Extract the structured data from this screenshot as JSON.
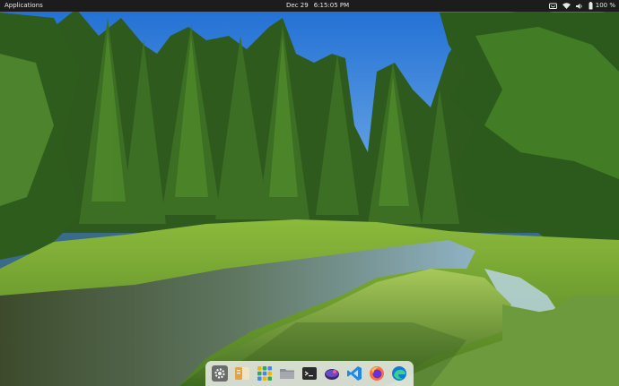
{
  "top_panel": {
    "applications_label": "Applications",
    "date": "Dec 29",
    "time": "6:15:05 PM",
    "battery_percent": "100 %",
    "tray_icons": [
      "notifications-icon",
      "network-icon",
      "volume-icon",
      "battery-icon"
    ]
  },
  "dock": {
    "items": [
      {
        "name": "settings-icon"
      },
      {
        "name": "files-icon"
      },
      {
        "name": "app-center-icon"
      },
      {
        "name": "folder-icon"
      },
      {
        "name": "terminal-icon"
      },
      {
        "name": "slack-icon"
      },
      {
        "name": "vscode-icon"
      },
      {
        "name": "firefox-icon"
      },
      {
        "name": "edge-icon"
      }
    ]
  },
  "colors": {
    "panel_bg": "#1c1c1c",
    "dock_bg": "#f5f5f5",
    "sky": "#2f7fd8",
    "grass": "#7fae2f",
    "water": "#3c4e35"
  }
}
